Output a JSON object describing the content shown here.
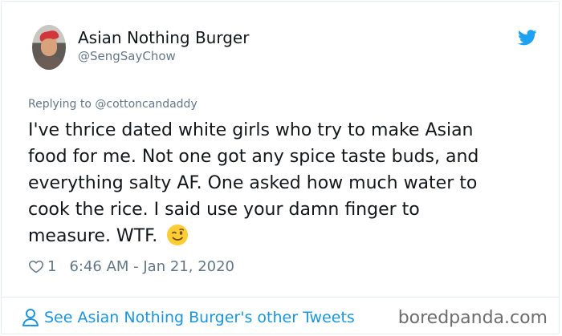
{
  "tweet": {
    "display_name": "Asian Nothing Burger",
    "handle": "@SengSayChow",
    "replying_to": "Replying to @cottoncandaddy",
    "text_lines": [
      "I've thrice dated white girls who try to make Asian",
      "food for me. Not one got any spice taste buds, and",
      "everything salty AF. One asked how much water to",
      "cook the rice. I said use your damn finger to",
      "measure. WTF."
    ],
    "like_count": "1",
    "timestamp": "6:46 AM - Jan 21, 2020",
    "see_more": "See Asian Nothing Burger's other Tweets"
  },
  "icons": {
    "brand": "twitter-bird-icon",
    "emoji": "winking-face-emoji",
    "like": "heart-icon",
    "profile": "person-icon"
  },
  "watermark": "boredpanda.com",
  "colors": {
    "twitter_blue": "#1da1f2",
    "link_blue": "#1b95e0",
    "muted_gray": "#657786",
    "text_dark": "#14171a"
  }
}
